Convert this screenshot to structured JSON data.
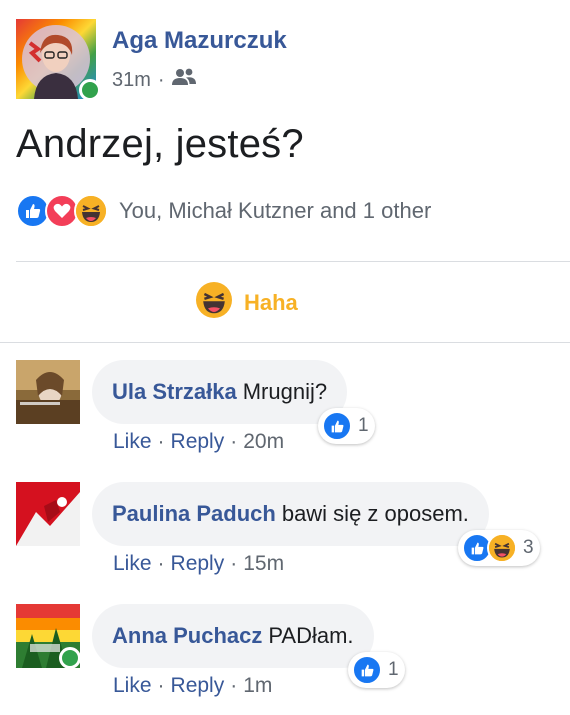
{
  "post": {
    "author": "Aga Mazurczuk",
    "time": "31m",
    "separator": "·",
    "audience_icon": "friends-icon",
    "text": "Andrzej, jesteś?",
    "reactions_summary": "You, Michał Kutzner and 1 other",
    "reaction_icons": [
      "like-icon",
      "love-icon",
      "haha-icon"
    ],
    "my_reaction_label": "Haha"
  },
  "comments": [
    {
      "author": "Ula Strzałka",
      "text": "Mrugnij?",
      "like": "Like",
      "dot": "·",
      "reply": "Reply",
      "time": "20m",
      "reaction_count": "1",
      "reaction_icons": [
        "like-icon"
      ]
    },
    {
      "author": "Paulina Paduch",
      "text": "bawi się z oposem.",
      "like": "Like",
      "dot": "·",
      "reply": "Reply",
      "time": "15m",
      "reaction_count": "3",
      "reaction_icons": [
        "like-icon",
        "haha-icon"
      ]
    },
    {
      "author": "Anna Puchacz",
      "text": "PADłam.",
      "like": "Like",
      "dot": "·",
      "reply": "Reply",
      "time": "1m",
      "reaction_count": "1",
      "reaction_icons": [
        "like-icon"
      ]
    }
  ],
  "colors": {
    "name_link": "#385898",
    "meta_gray": "#606770",
    "haha_accent": "#f7b125",
    "like_blue": "#1877f2",
    "love_red": "#f33e58",
    "online_green": "#31a24c",
    "bubble_bg": "#f2f3f5"
  }
}
